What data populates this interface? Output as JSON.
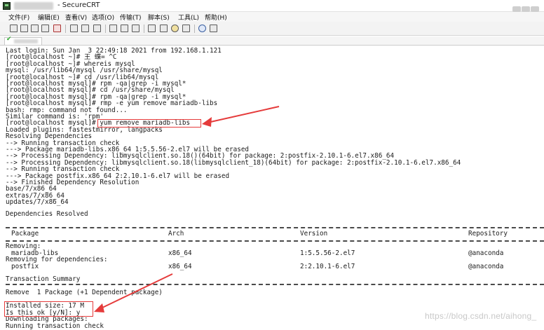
{
  "window": {
    "title": "- SecureCRT"
  },
  "menu": [
    "文件(F)",
    "编辑(E)",
    "查看(V)",
    "选项(O)",
    "传输(T)",
    "脚本(S)",
    "工具(L)",
    "帮助(H)"
  ],
  "terminal": {
    "lines": [
      "Last login: Sun Jan  3 22:49:18 2021 from 192.168.1.121",
      "[root@localhost ~]# 王 蝶= ^C",
      "[root@localhost ~]# whereis mysql",
      "mysql: /usr/lib64/mysql /usr/share/mysql",
      "[root@localhost ~]# cd /usr/lib64/mysql",
      "[root@localhost mysql]# rpm -qa|grep -i mysql*",
      "[root@localhost mysql]# cd /usr/share/mysql",
      "[root@localhost mysql]# rpm -qa|grep -i mysql*",
      "[root@localhost mysql]# rmp -e yum remove mariadb-libs",
      "bash: rmp: command not found...",
      "Similar command is: 'rpm'",
      "[root@localhost mysql]# yum remove mariadb-libs",
      "Loaded plugins: fastestmirror, langpacks",
      "Resolving Dependencies",
      "--> Running transaction check",
      "---> Package mariadb-libs.x86_64 1:5.5.56-2.el7 will be erased",
      "--> Processing Dependency: libmysqlclient.so.18()(64bit) for package: 2:postfix-2.10.1-6.el7.x86_64",
      "--> Processing Dependency: libmysqlclient.so.18(libmysqlclient_18)(64bit) for package: 2:postfix-2.10.1-6.el7.x86_64",
      "--> Running transaction check",
      "---> Package postfix.x86_64 2:2.10.1-6.el7 will be erased",
      "--> Finished Dependency Resolution",
      "base/7/x86_64",
      "extras/7/x86_64",
      "updates/7/x86_64",
      "",
      "Dependencies Resolved"
    ],
    "table": {
      "headers": [
        "Package",
        "Arch",
        "Version",
        "Repository"
      ],
      "removing_label": "Removing:",
      "rows1": [
        [
          "mariadb-libs",
          "x86_64",
          "1:5.5.56-2.el7",
          "@anaconda"
        ]
      ],
      "deps_label": "Removing for dependencies:",
      "rows2": [
        [
          "postfix",
          "x86_64",
          "2:2.10.1-6.el7",
          "@anaconda"
        ]
      ]
    },
    "summary": "Transaction Summary",
    "remove_line": "Remove  1 Package (+1 Dependent package)",
    "installed_size": "Installed size: 17 M",
    "prompt": "Is this ok [y/N]: y",
    "downloading": "Downloading packages:",
    "running": "Running transaction check"
  },
  "watermark": "https://blog.csdn.net/aihong_",
  "colors": {
    "annotation": "#e53b3b",
    "tab_check": "#2fa82f"
  }
}
